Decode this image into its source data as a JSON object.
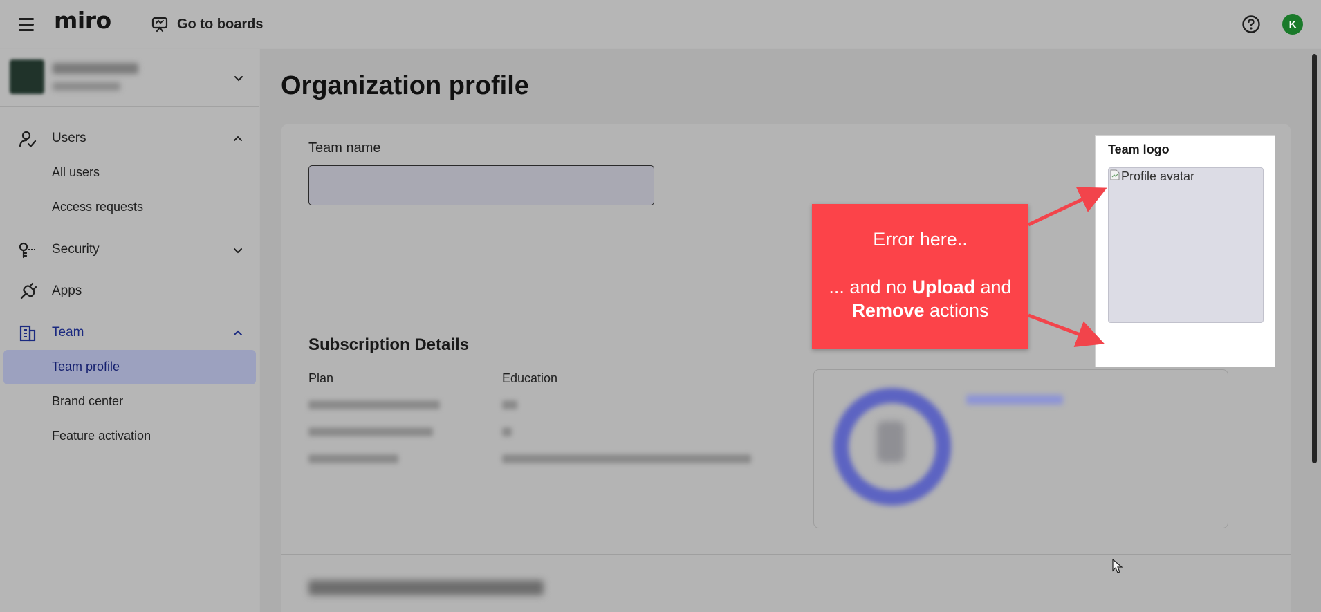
{
  "topbar": {
    "brand": "miro",
    "go_to_boards_label": "Go to boards",
    "avatar_initial": "K"
  },
  "sidebar": {
    "groups": [
      {
        "label": "Users",
        "expanded": true,
        "items": [
          "All users",
          "Access requests"
        ]
      },
      {
        "label": "Security",
        "expanded": false
      },
      {
        "label": "Apps"
      },
      {
        "label": "Team",
        "expanded": true,
        "active": true,
        "items": [
          "Team profile",
          "Brand center",
          "Feature activation"
        ]
      }
    ],
    "selected_item": "Team profile"
  },
  "main": {
    "page_title": "Organization profile",
    "team_name_label": "Team name",
    "team_name_value": "",
    "subscription_title": "Subscription Details",
    "plan_label": "Plan",
    "plan_value": "Education"
  },
  "team_logo": {
    "title": "Team logo",
    "image_alt": "Profile avatar"
  },
  "annotation": {
    "line1": "Error here..",
    "line2_prefix": "... and no ",
    "upload_word": "Upload",
    "line2_mid": " and",
    "remove_word": "Remove",
    "line2_suffix": " actions",
    "color": "#fc4349"
  },
  "colors": {
    "active_nav": "#1b2a80",
    "selected_bg": "#9ca1bf",
    "avatar_bg": "#1a7a2a"
  }
}
